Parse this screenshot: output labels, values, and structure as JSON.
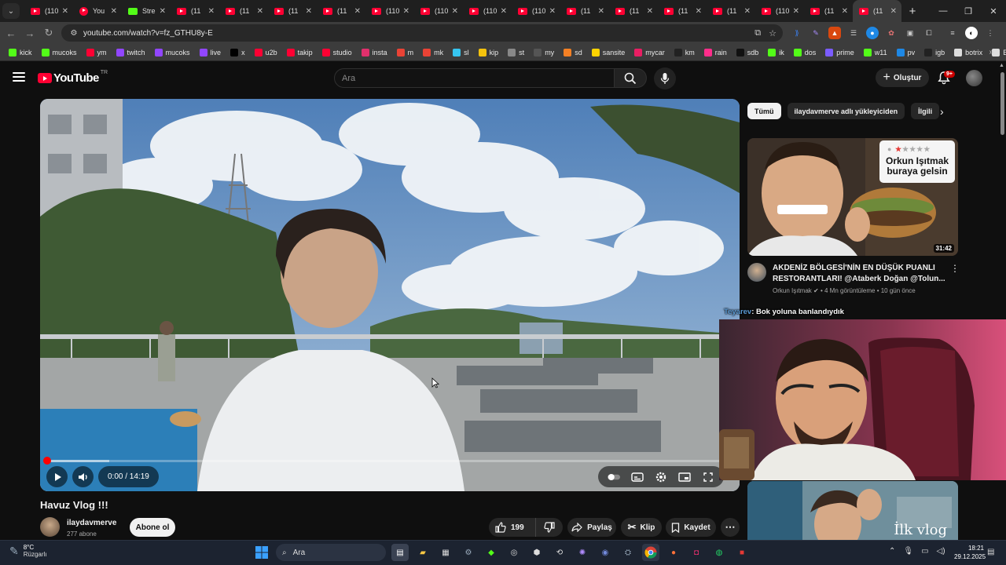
{
  "browser": {
    "tabs": [
      {
        "title": "(110",
        "icon": "youtube-icon"
      },
      {
        "title": "You",
        "icon": "youtube-round-icon"
      },
      {
        "title": "Stre",
        "icon": "kick-icon"
      },
      {
        "title": "(11",
        "icon": "youtube-icon"
      },
      {
        "title": "(11",
        "icon": "youtube-icon"
      },
      {
        "title": "(11",
        "icon": "youtube-icon"
      },
      {
        "title": "(11",
        "icon": "youtube-icon"
      },
      {
        "title": "(110",
        "icon": "youtube-icon"
      },
      {
        "title": "(110",
        "icon": "youtube-icon"
      },
      {
        "title": "(110",
        "icon": "youtube-icon"
      },
      {
        "title": "(110",
        "icon": "youtube-icon"
      },
      {
        "title": "(11",
        "icon": "youtube-icon"
      },
      {
        "title": "(11",
        "icon": "youtube-icon"
      },
      {
        "title": "(11",
        "icon": "youtube-icon"
      },
      {
        "title": "(11",
        "icon": "youtube-icon"
      },
      {
        "title": "(110",
        "icon": "youtube-icon"
      },
      {
        "title": "(11",
        "icon": "youtube-icon"
      },
      {
        "title": "(11",
        "icon": "youtube-icon",
        "active": true
      }
    ],
    "url": "youtube.com/watch?v=fz_GTHU8y-E",
    "bookmarks": [
      {
        "label": "kick",
        "color": "#53fc18"
      },
      {
        "label": "mucoks",
        "color": "#53fc18"
      },
      {
        "label": "ym",
        "color": "#ff0033"
      },
      {
        "label": "twitch",
        "color": "#9146ff"
      },
      {
        "label": "mucoks",
        "color": "#9146ff"
      },
      {
        "label": "live",
        "color": "#9146ff"
      },
      {
        "label": "x",
        "color": "#000000"
      },
      {
        "label": "u2b",
        "color": "#ff0033"
      },
      {
        "label": "takip",
        "color": "#ff0033"
      },
      {
        "label": "studio",
        "color": "#ff0033"
      },
      {
        "label": "insta",
        "color": "#e1306c"
      },
      {
        "label": "m",
        "color": "#ea4335"
      },
      {
        "label": "mk",
        "color": "#ea4335"
      },
      {
        "label": "sl",
        "color": "#36c5f0"
      },
      {
        "label": "kip",
        "color": "#f4c20d"
      },
      {
        "label": "st",
        "color": "#888888"
      },
      {
        "label": "my",
        "color": "#555555"
      },
      {
        "label": "sd",
        "color": "#f48024"
      },
      {
        "label": "sansite",
        "color": "#ffd400"
      },
      {
        "label": "mycar",
        "color": "#e91e63"
      },
      {
        "label": "km",
        "color": "#222222"
      },
      {
        "label": "rain",
        "color": "#ff2d8b"
      },
      {
        "label": "sdb",
        "color": "#111111"
      },
      {
        "label": "ik",
        "color": "#53fc18"
      },
      {
        "label": "dos",
        "color": "#53fc18"
      },
      {
        "label": "prime",
        "color": "#7b5cff"
      },
      {
        "label": "w11",
        "color": "#53fc18"
      },
      {
        "label": "pv",
        "color": "#1e88e5"
      },
      {
        "label": "igb",
        "color": "#222222"
      },
      {
        "label": "botrix",
        "color": "#dddddd"
      },
      {
        "label": "ByNo",
        "color": "#dddddd"
      }
    ]
  },
  "youtube": {
    "logo_text": "YouTube",
    "country_code": "TR",
    "search_placeholder": "Ara",
    "create_label": "Oluştur",
    "notification_count": "9+"
  },
  "video": {
    "title": "Havuz Vlog !!!",
    "time": "0:00 / 14:19",
    "channel": "ilaydavmerve",
    "subscribers": "277 abone",
    "subscribe_label": "Abone ol",
    "likes": "199",
    "share_label": "Paylaş",
    "clip_label": "Klip",
    "save_label": "Kaydet",
    "progress_fraction": 0.0
  },
  "sidebar": {
    "chips": [
      "Tümü",
      "ilaydavmerve adlı yükleyiciden",
      "İlgili"
    ],
    "recommendation": {
      "title": "AKDENİZ BÖLGESİ'NİN EN DÜŞÜK PUANLI RESTORANTLARI! @Ataberk Doğan @Tolun...",
      "channel": "Orkun Işıtmak",
      "views": "4 Mn görüntüleme",
      "age": "10 gün önce",
      "duration": "31:42",
      "thumb_text": "Orkun Işıtmak buraya gelsin"
    },
    "recommendation2": {
      "thumb_text": "İlk vlog"
    }
  },
  "overlay": {
    "chat_user": "Teyarev",
    "chat_message": ": Bok yoluna banlandıydık"
  },
  "taskbar": {
    "temperature": "8°C",
    "condition": "Rüzgarlı",
    "search_placeholder": "Ara",
    "time": "18:21",
    "date": "29.12.2025"
  }
}
